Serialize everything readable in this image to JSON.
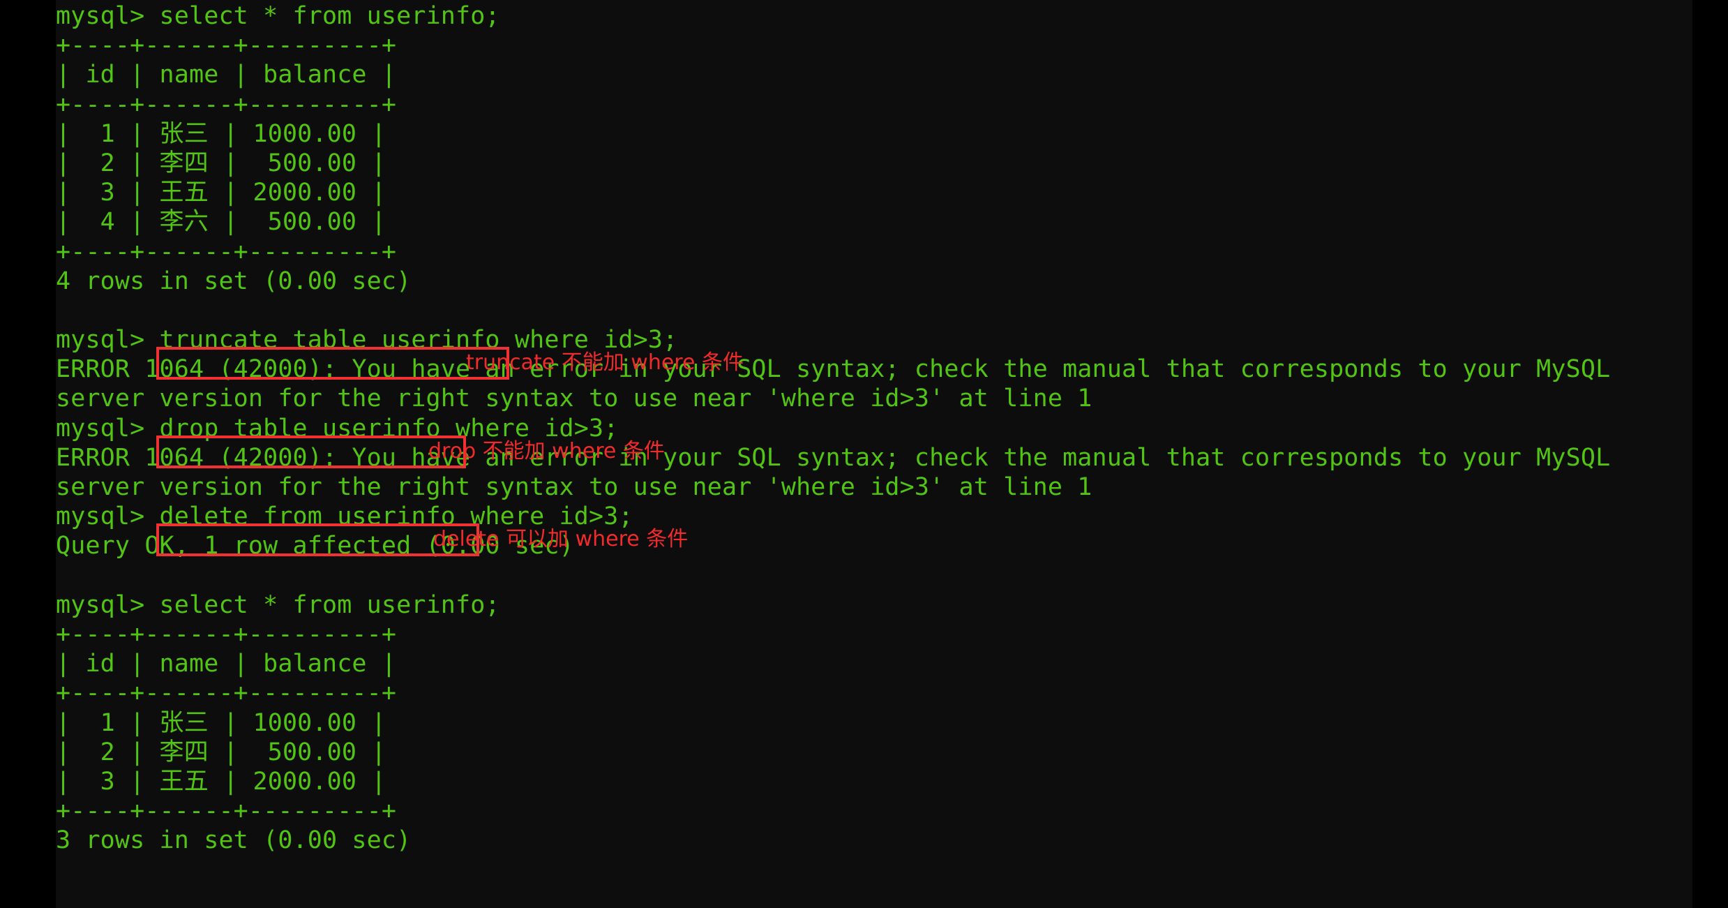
{
  "terminal": {
    "background": "#0d0d0d",
    "outer_background": "#000000",
    "text_color": "#52c414",
    "annotation_color": "#f02b2b",
    "highlight_box_color": "#f03232",
    "prompt": "mysql> ",
    "lines": [
      {
        "id": "l01",
        "text": "mysql> select * from userinfo;"
      },
      {
        "id": "l02",
        "text": "+----+------+---------+"
      },
      {
        "id": "l03",
        "text": "| id | name | balance |"
      },
      {
        "id": "l04",
        "text": "+----+------+---------+"
      },
      {
        "id": "l05",
        "text": "|  1 | 张三 | 1000.00 |"
      },
      {
        "id": "l06",
        "text": "|  2 | 李四 |  500.00 |"
      },
      {
        "id": "l07",
        "text": "|  3 | 王五 | 2000.00 |"
      },
      {
        "id": "l08",
        "text": "|  4 | 李六 |  500.00 |"
      },
      {
        "id": "l09",
        "text": "+----+------+---------+"
      },
      {
        "id": "l10",
        "text": "4 rows in set (0.00 sec)"
      },
      {
        "id": "l11",
        "text": ""
      },
      {
        "id": "l12",
        "text": "mysql> truncate table userinfo where id>3;"
      },
      {
        "id": "l13",
        "text": "ERROR 1064 (42000): You have an error in your SQL syntax; check the manual that corresponds to your MySQL"
      },
      {
        "id": "l14",
        "text": "server version for the right syntax to use near 'where id>3' at line 1"
      },
      {
        "id": "l15",
        "text": "mysql> drop table userinfo where id>3;"
      },
      {
        "id": "l16",
        "text": "ERROR 1064 (42000): You have an error in your SQL syntax; check the manual that corresponds to your MySQL"
      },
      {
        "id": "l17",
        "text": "server version for the right syntax to use near 'where id>3' at line 1"
      },
      {
        "id": "l18",
        "text": "mysql> delete from userinfo where id>3;"
      },
      {
        "id": "l19",
        "text": "Query OK, 1 row affected (0.00 sec)"
      },
      {
        "id": "l20",
        "text": ""
      },
      {
        "id": "l21",
        "text": "mysql> select * from userinfo;"
      },
      {
        "id": "l22",
        "text": "+----+------+---------+"
      },
      {
        "id": "l23",
        "text": "| id | name | balance |"
      },
      {
        "id": "l24",
        "text": "+----+------+---------+"
      },
      {
        "id": "l25",
        "text": "|  1 | 张三 | 1000.00 |"
      },
      {
        "id": "l26",
        "text": "|  2 | 李四 |  500.00 |"
      },
      {
        "id": "l27",
        "text": "|  3 | 王五 | 2000.00 |"
      },
      {
        "id": "l28",
        "text": "+----+------+---------+"
      },
      {
        "id": "l29",
        "text": "3 rows in set (0.00 sec)"
      }
    ]
  },
  "queries": [
    {
      "name": "select-before",
      "sql": "select * from userinfo;",
      "result_summary": "4 rows in set (0.00 sec)"
    },
    {
      "name": "truncate-with-where",
      "sql": "truncate table userinfo where id>3;",
      "error_line_1": "ERROR 1064 (42000): You have an error in your SQL syntax; check the manual that corresponds to your MySQL",
      "error_line_2": "server version for the right syntax to use near 'where id>3' at line 1"
    },
    {
      "name": "drop-with-where",
      "sql": "drop table userinfo where id>3;",
      "error_line_1": "ERROR 1064 (42000): You have an error in your SQL syntax; check the manual that corresponds to your MySQL",
      "error_line_2": "server version for the right syntax to use near 'where id>3' at line 1"
    },
    {
      "name": "delete-with-where",
      "sql": "delete from userinfo where id>3;",
      "result_summary": "Query OK, 1 row affected (0.00 sec)"
    },
    {
      "name": "select-after",
      "sql": "select * from userinfo;",
      "result_summary": "3 rows in set (0.00 sec)"
    }
  ],
  "tables": {
    "before": {
      "columns": [
        "id",
        "name",
        "balance"
      ],
      "rows": [
        [
          "1",
          "张三",
          "1000.00"
        ],
        [
          "2",
          "李四",
          "500.00"
        ],
        [
          "3",
          "王五",
          "2000.00"
        ],
        [
          "4",
          "李六",
          "500.00"
        ]
      ],
      "row_count_text": "4 rows in set (0.00 sec)"
    },
    "after": {
      "columns": [
        "id",
        "name",
        "balance"
      ],
      "rows": [
        [
          "1",
          "张三",
          "1000.00"
        ],
        [
          "2",
          "李四",
          "500.00"
        ],
        [
          "3",
          "王五",
          "2000.00"
        ]
      ],
      "row_count_text": "3 rows in set (0.00 sec)"
    }
  },
  "annotations": [
    {
      "id": "a1",
      "text": "truncate 不能加 where 条件",
      "target": "truncate-with-where"
    },
    {
      "id": "a2",
      "text": "drop 不能加 where 条件",
      "target": "drop-with-where"
    },
    {
      "id": "a3",
      "text": "delete 可以加 where 条件",
      "target": "delete-with-where"
    }
  ]
}
